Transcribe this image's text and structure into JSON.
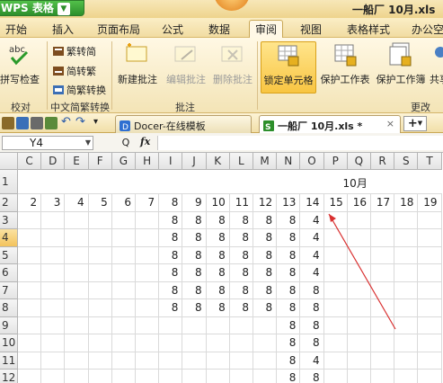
{
  "app": {
    "name": "WPS 表格",
    "doc_title": "一船厂 10月.xls"
  },
  "menu": [
    "开始",
    "插入",
    "页面布局",
    "公式",
    "数据",
    "审阅",
    "视图",
    "表格样式",
    "办公空间"
  ],
  "menu_active_index": 5,
  "ribbon": {
    "proofing": {
      "spell_check": "拼写检查",
      "group_label": "校对"
    },
    "chinese_convert": {
      "trad_to_simp": "繁转简",
      "simp_to_trad": "简转繁",
      "convert": "简繁转换",
      "group_label": "中文简繁转换"
    },
    "comments": {
      "new": "新建批注",
      "edit": "编辑批注",
      "delete": "删除批注",
      "group_label": "批注"
    },
    "changes": {
      "lock_cell": "锁定单元格",
      "protect_sheet": "保护工作表",
      "protect_workbook": "保护工作簿",
      "share": "共享",
      "group_label": "更改"
    }
  },
  "tabs": [
    {
      "label": "Docer-在线模板",
      "closable": false
    },
    {
      "label": "一船厂 10月.xls *",
      "closable": true
    }
  ],
  "tab_add": "+",
  "formula_bar": {
    "name_box": "Y4",
    "fx": "fx",
    "zoom_icon": "Q",
    "content": ""
  },
  "sheet": {
    "columns": [
      "C",
      "D",
      "E",
      "F",
      "G",
      "H",
      "I",
      "J",
      "K",
      "L",
      "M",
      "N",
      "O",
      "P",
      "Q",
      "R",
      "S",
      "T"
    ],
    "rows": [
      "1",
      "2",
      "3",
      "4",
      "5",
      "6",
      "7",
      "8",
      "9",
      "10",
      "11",
      "12"
    ],
    "selected_row": "4",
    "title_cell": "10月",
    "day_row": [
      "2",
      "3",
      "4",
      "5",
      "6",
      "7",
      "8",
      "9",
      "10",
      "11",
      "12",
      "13",
      "14",
      "15",
      "16",
      "17",
      "18",
      "19"
    ],
    "values": [
      [
        "",
        "",
        "",
        "",
        "",
        "",
        "8",
        "8",
        "8",
        "8",
        "8",
        "8",
        "4",
        "",
        "",
        "",
        "",
        ""
      ],
      [
        "",
        "",
        "",
        "",
        "",
        "",
        "8",
        "8",
        "8",
        "8",
        "8",
        "8",
        "4",
        "",
        "",
        "",
        "",
        ""
      ],
      [
        "",
        "",
        "",
        "",
        "",
        "",
        "8",
        "8",
        "8",
        "8",
        "8",
        "8",
        "4",
        "",
        "",
        "",
        "",
        ""
      ],
      [
        "",
        "",
        "",
        "",
        "",
        "",
        "8",
        "8",
        "8",
        "8",
        "8",
        "8",
        "4",
        "",
        "",
        "",
        "",
        ""
      ],
      [
        "",
        "",
        "",
        "",
        "",
        "",
        "8",
        "8",
        "8",
        "8",
        "8",
        "8",
        "8",
        "",
        "",
        "",
        "",
        ""
      ],
      [
        "",
        "",
        "",
        "",
        "",
        "",
        "8",
        "8",
        "8",
        "8",
        "8",
        "8",
        "8",
        "",
        "",
        "",
        "",
        ""
      ],
      [
        "",
        "",
        "",
        "",
        "",
        "",
        "",
        "",
        "",
        "",
        "",
        "8",
        "8",
        "",
        "",
        "",
        "",
        ""
      ],
      [
        "",
        "",
        "",
        "",
        "",
        "",
        "",
        "",
        "",
        "",
        "",
        "8",
        "8",
        "",
        "",
        "",
        "",
        ""
      ],
      [
        "",
        "",
        "",
        "",
        "",
        "",
        "",
        "",
        "",
        "",
        "",
        "8",
        "4",
        "",
        "",
        "",
        "",
        ""
      ],
      [
        "",
        "",
        "",
        "",
        "",
        "",
        "",
        "",
        "",
        "",
        "",
        "8",
        "8",
        "",
        "",
        "",
        "",
        ""
      ]
    ]
  },
  "colors": {
    "arrow": "#d93030",
    "accent": "#2d8f2b",
    "selection": "#f3c35d"
  }
}
